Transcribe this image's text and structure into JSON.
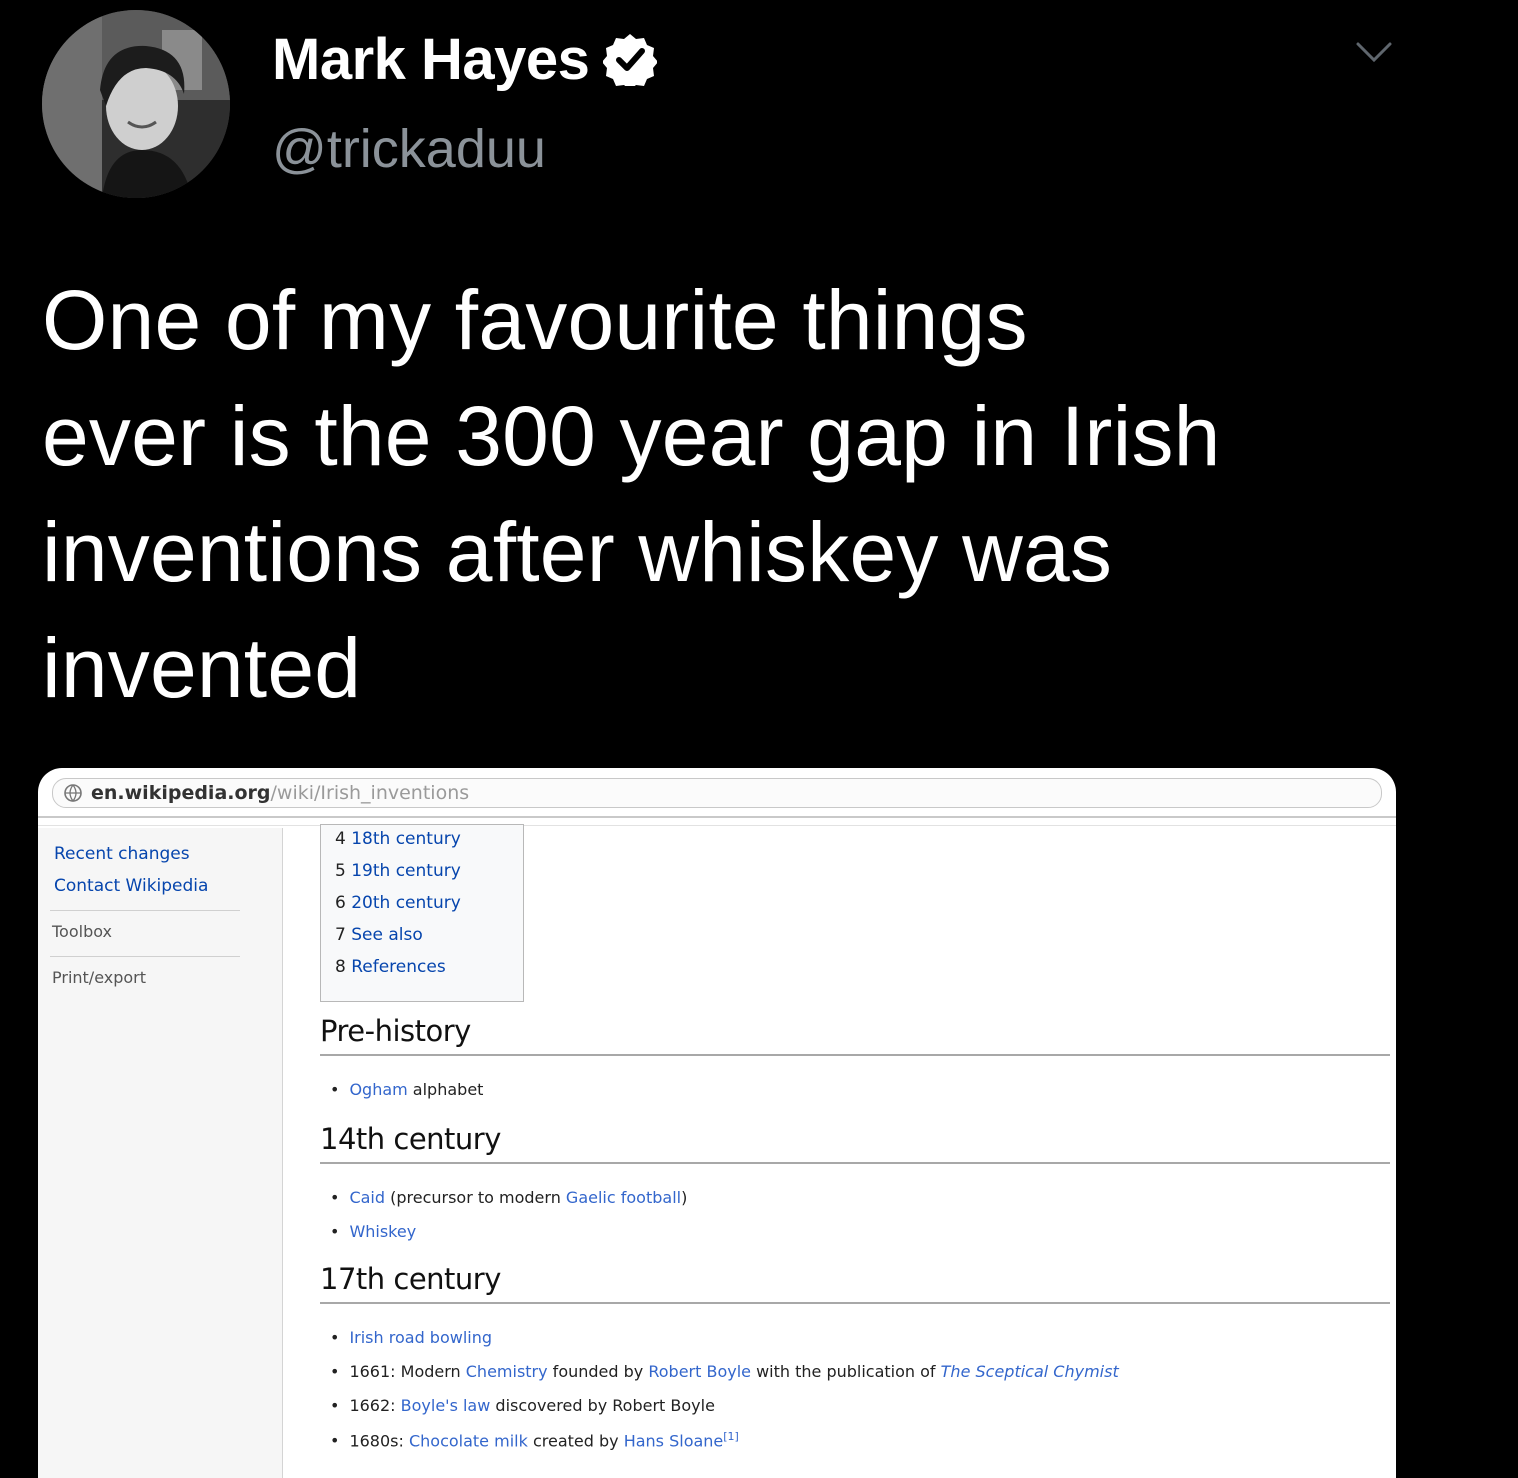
{
  "tweet": {
    "author_name": "Mark Hayes",
    "handle": "@trickaduu",
    "verified": true,
    "text_lines": [
      "One of my favourite things",
      "ever is the 300 year gap in Irish",
      "inventions after whiskey was",
      "invented"
    ],
    "icons": {
      "avatar": "profile-photo",
      "verified": "verified-badge-icon",
      "menu": "chevron-down-icon"
    }
  },
  "screenshot": {
    "url": {
      "host": "en.wikipedia.org",
      "path": "/wiki/Irish_inventions"
    },
    "sidebar": {
      "links": [
        "Recent changes",
        "Contact Wikipedia"
      ],
      "headings": [
        "Toolbox",
        "Print/export"
      ]
    },
    "toc": [
      {
        "num": "4",
        "label": "18th century"
      },
      {
        "num": "5",
        "label": "19th century"
      },
      {
        "num": "6",
        "label": "20th century"
      },
      {
        "num": "7",
        "label": "See also"
      },
      {
        "num": "8",
        "label": "References"
      }
    ],
    "sections": {
      "prehistory": {
        "title": "Pre-history",
        "items": [
          {
            "link": "Ogham",
            "text": " alphabet"
          }
        ]
      },
      "c14": {
        "title": "14th century",
        "items": [
          {
            "link": "Caid",
            "text_a": " (precursor to modern ",
            "link2": "Gaelic football",
            "text_b": ")"
          },
          {
            "link": "Whiskey"
          }
        ]
      },
      "c17": {
        "title": "17th century",
        "items": [
          {
            "link": "Irish road bowling"
          },
          {
            "prefix": "1661: Modern ",
            "link": "Chemistry",
            "mid": " founded by ",
            "link2": "Robert Boyle",
            "mid2": " with the publication of ",
            "link3": "The Sceptical Chymist"
          },
          {
            "prefix": "1662: ",
            "link": "Boyle's law",
            "mid": " discovered by Robert Boyle"
          },
          {
            "prefix": "1680s: ",
            "link": "Chocolate milk",
            "mid": " created by ",
            "link2": "Hans Sloane",
            "sup": "[1]"
          }
        ]
      }
    }
  }
}
